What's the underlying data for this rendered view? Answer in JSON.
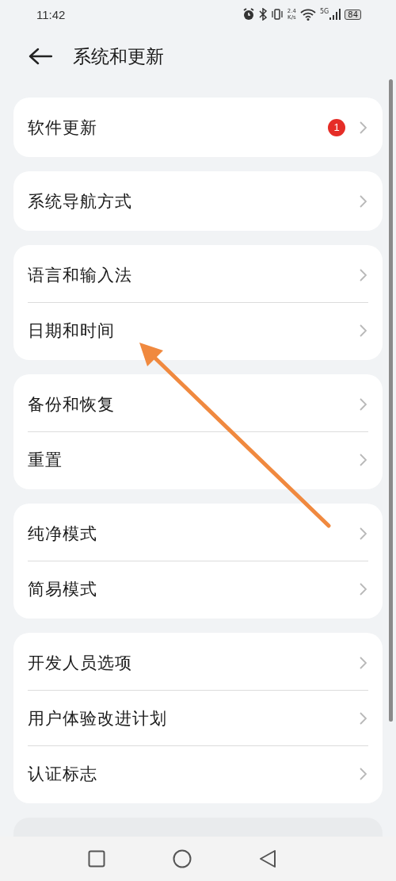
{
  "status_bar": {
    "time": "11:42",
    "speed_value": "2.4",
    "speed_unit": "K/s",
    "network": "5G",
    "battery": "84"
  },
  "header": {
    "title": "系统和更新"
  },
  "groups": [
    {
      "items": [
        {
          "label": "软件更新",
          "badge": "1"
        }
      ]
    },
    {
      "items": [
        {
          "label": "系统导航方式"
        }
      ]
    },
    {
      "items": [
        {
          "label": "语言和输入法"
        },
        {
          "label": "日期和时间"
        }
      ]
    },
    {
      "items": [
        {
          "label": "备份和恢复"
        },
        {
          "label": "重置"
        }
      ]
    },
    {
      "items": [
        {
          "label": "纯净模式"
        },
        {
          "label": "简易模式"
        }
      ]
    },
    {
      "items": [
        {
          "label": "开发人员选项"
        },
        {
          "label": "用户体验改进计划"
        },
        {
          "label": "认证标志"
        }
      ]
    }
  ]
}
